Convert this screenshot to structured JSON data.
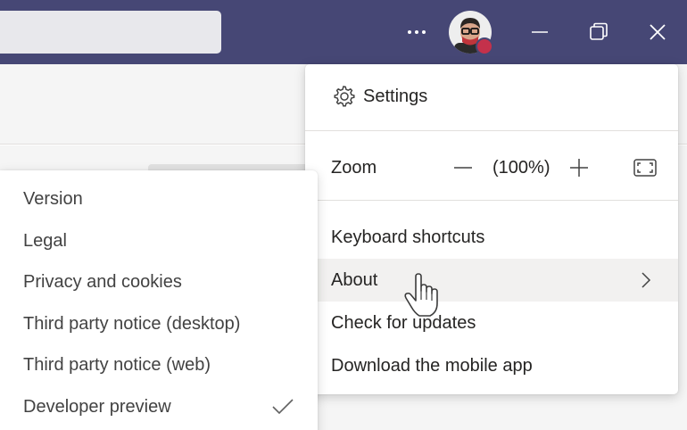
{
  "titlebar": {
    "search_placeholder": "",
    "more_icon": "more-horizontal-icon",
    "presence_color": "#c4314b",
    "bar_color": "#464775"
  },
  "main_menu": {
    "settings_label": "Settings",
    "zoom_label": "Zoom",
    "zoom_value": "(100%)",
    "items": [
      {
        "label": "Keyboard shortcuts"
      },
      {
        "label": "About"
      },
      {
        "label": "Check for updates"
      },
      {
        "label": "Download the mobile app"
      }
    ],
    "highlighted_item": "About",
    "highlight_color": "#f2f1f0"
  },
  "about_submenu": {
    "items": [
      {
        "label": "Version"
      },
      {
        "label": "Legal"
      },
      {
        "label": "Privacy and cookies"
      },
      {
        "label": "Third party notice (desktop)"
      },
      {
        "label": "Third party notice (web)"
      },
      {
        "label": "Developer preview",
        "checked": true
      }
    ]
  }
}
